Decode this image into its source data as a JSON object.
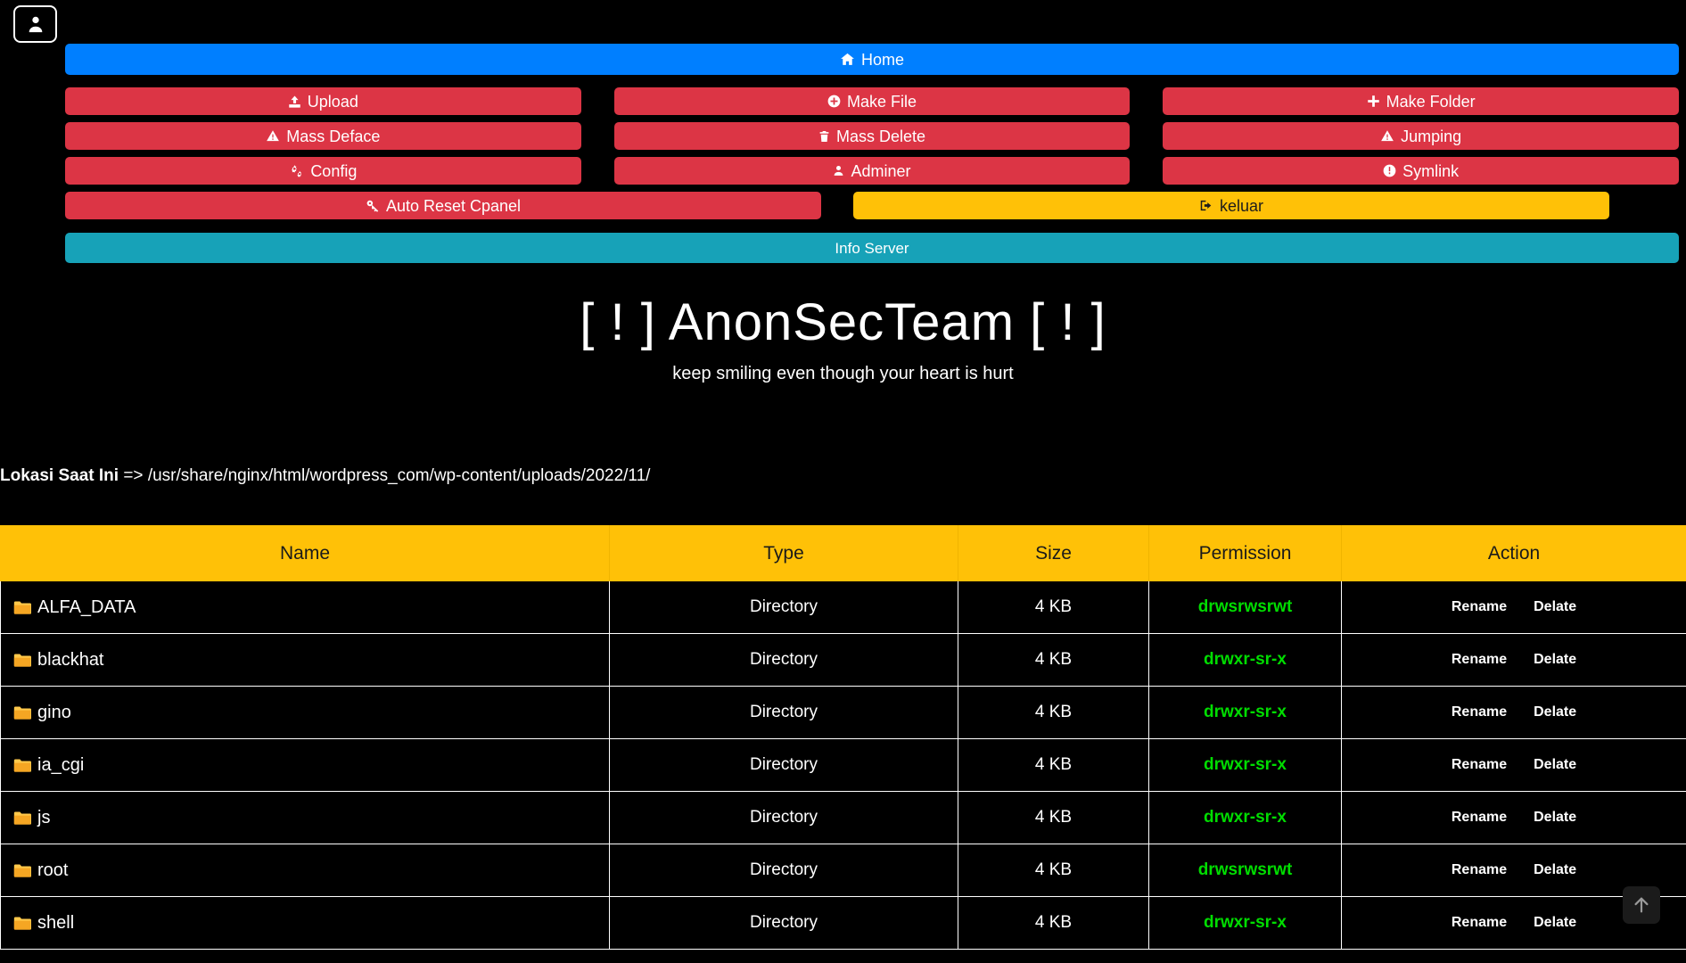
{
  "avatar": {
    "icon": "user-icon"
  },
  "nav": {
    "home": {
      "label": "Home",
      "icon": "home-icon",
      "color": "#007fff"
    },
    "buttons": [
      {
        "label": "Upload",
        "icon": "upload-icon",
        "color": "#dc3545"
      },
      {
        "label": "Make File",
        "icon": "plus-circle-icon",
        "color": "#dc3545"
      },
      {
        "label": "Make Folder",
        "icon": "plus-icon",
        "color": "#dc3545"
      },
      {
        "label": "Mass Deface",
        "icon": "warning-triangle-icon",
        "color": "#dc3545"
      },
      {
        "label": "Mass Delete",
        "icon": "trash-icon",
        "color": "#dc3545"
      },
      {
        "label": "Jumping",
        "icon": "warning-triangle-icon",
        "color": "#dc3545"
      },
      {
        "label": "Config",
        "icon": "cogs-icon",
        "color": "#dc3545"
      },
      {
        "label": "Adminer",
        "icon": "user-icon",
        "color": "#dc3545"
      },
      {
        "label": "Symlink",
        "icon": "exclamation-circle-icon",
        "color": "#dc3545"
      }
    ],
    "reset": {
      "label": "Auto Reset Cpanel",
      "icon": "key-icon",
      "color": "#dc3545"
    },
    "logout": {
      "label": "keluar",
      "icon": "sign-out-icon",
      "color": "#ffc107"
    },
    "info": {
      "label": "Info Server",
      "color": "#17a2b8"
    }
  },
  "banner": {
    "title": "[ ! ] AnonSecTeam [ ! ]",
    "subtitle": "keep smiling even though your heart is hurt"
  },
  "path": {
    "label": "Lokasi Saat Ini",
    "separator": "=>",
    "value": "/usr/share/nginx/html/wordpress_com/wp-content/uploads/2022/11/"
  },
  "table": {
    "headers": [
      "Name",
      "Type",
      "Size",
      "Permission",
      "Action"
    ],
    "action_labels": {
      "rename": "Rename",
      "delete": "Delate"
    },
    "rows": [
      {
        "name": "ALFA_DATA",
        "icon": "folder-icon",
        "type": "Directory",
        "size": "4 KB",
        "permission": "drwsrwsrwt"
      },
      {
        "name": "blackhat",
        "icon": "folder-icon",
        "type": "Directory",
        "size": "4 KB",
        "permission": "drwxr-sr-x"
      },
      {
        "name": "gino",
        "icon": "folder-icon",
        "type": "Directory",
        "size": "4 KB",
        "permission": "drwxr-sr-x"
      },
      {
        "name": "ia_cgi",
        "icon": "folder-icon",
        "type": "Directory",
        "size": "4 KB",
        "permission": "drwxr-sr-x"
      },
      {
        "name": "js",
        "icon": "folder-icon",
        "type": "Directory",
        "size": "4 KB",
        "permission": "drwxr-sr-x"
      },
      {
        "name": "root",
        "icon": "folder-icon",
        "type": "Directory",
        "size": "4 KB",
        "permission": "drwsrwsrwt"
      },
      {
        "name": "shell",
        "icon": "folder-icon",
        "type": "Directory",
        "size": "4 KB",
        "permission": "drwxr-sr-x"
      }
    ]
  },
  "scroll_top": {
    "icon": "arrow-up-icon"
  }
}
